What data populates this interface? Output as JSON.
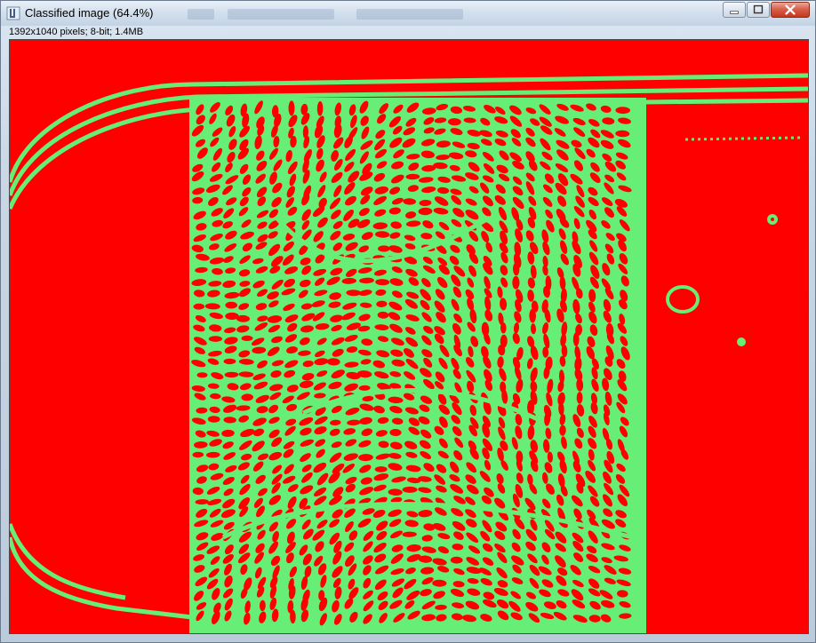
{
  "window": {
    "title": "Classified image (64.4%)",
    "icon": "imagej-icon",
    "controls": [
      "minimize-icon",
      "maximize-icon",
      "close-icon"
    ]
  },
  "status_bar": {
    "text": "1392x1040 pixels; 8-bit; 1.4MB"
  },
  "image": {
    "description_colors": {
      "background_class": "#ff0000",
      "foreground_class": "#66ee77"
    }
  }
}
